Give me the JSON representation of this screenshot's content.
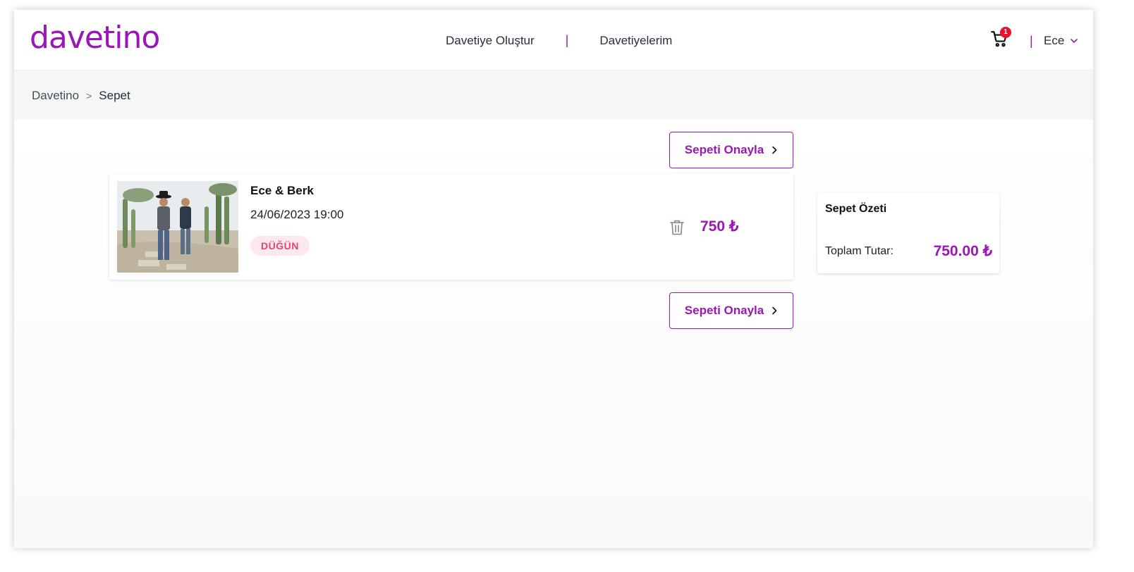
{
  "header": {
    "logo": "davetino",
    "nav": [
      {
        "label": "Davetiye Oluştur"
      },
      {
        "label": "Davetiyelerim"
      }
    ],
    "nav_separator": "|",
    "cart_count": "1",
    "user_name": "Ece"
  },
  "breadcrumb": {
    "root": "Davetino",
    "separator": ">",
    "current": "Sepet"
  },
  "actions": {
    "confirm_label": "Sepeti Onayla"
  },
  "cart": {
    "items": [
      {
        "title": "Ece & Berk",
        "datetime": "24/06/2023 19:00",
        "tag": "DÜĞÜN",
        "price": "750 ₺"
      }
    ]
  },
  "summary": {
    "title": "Sepet Özeti",
    "total_label": "Toplam Tutar:",
    "total_value": "750.00 ₺"
  },
  "colors": {
    "brand": "#9b16b8",
    "tag_bg": "#fde8ee",
    "tag_text": "#e0447a",
    "badge": "#e8132a"
  },
  "icons": [
    "cart-icon",
    "chevron-down-icon",
    "chevron-right-icon",
    "trash-icon"
  ]
}
